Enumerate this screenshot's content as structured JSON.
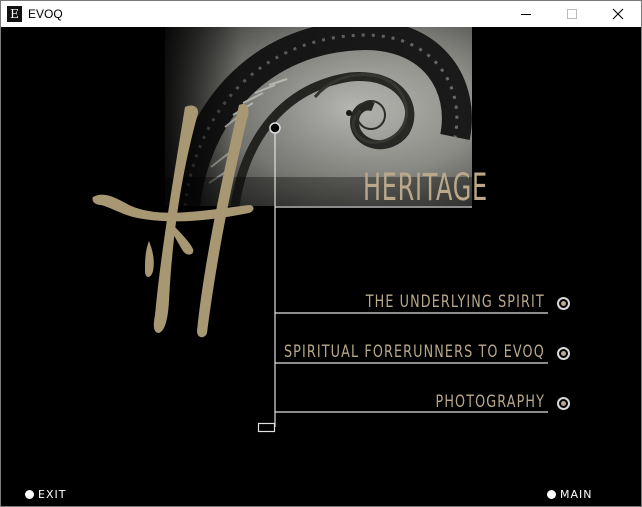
{
  "window": {
    "title": "EVOQ",
    "icon_letter": "E",
    "controls": [
      "minimize-icon",
      "maximize-icon",
      "close-icon"
    ]
  },
  "page": {
    "heading": "HERITAGE",
    "menu": [
      {
        "label": "THE UNDERLYING SPIRIT"
      },
      {
        "label": "SPIRITUAL FORERUNNERS TO EVOQ"
      },
      {
        "label": "PHOTOGRAPHY"
      }
    ]
  },
  "footer": {
    "exit_label": "EXIT",
    "main_label": "MAIN"
  },
  "colors": {
    "background": "#000000",
    "accent_gold": "#b9a98a",
    "line": "#e0e0e0",
    "titlebar": "#ffffff"
  }
}
